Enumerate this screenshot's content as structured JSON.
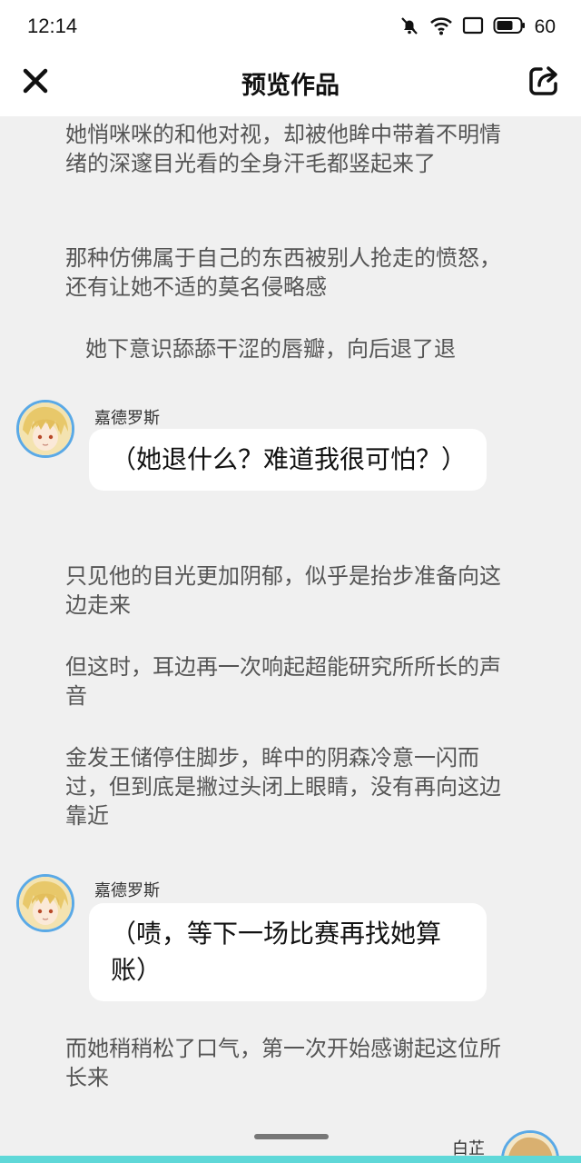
{
  "status_bar": {
    "time": "12:14",
    "battery": "60",
    "icons": [
      "mute-bell-icon",
      "wifi-icon",
      "screen-icon",
      "battery-icon"
    ]
  },
  "header": {
    "title": "预览作品",
    "close_icon": "close-icon",
    "share_icon": "share-icon"
  },
  "story": {
    "narration_1": "她悄咪咪的和他对视，却被他眸中带着不明情绪的深邃目光看的全身汗毛都竖起来了",
    "narration_2": "那种仿佛属于自己的东西被别人抢走的愤怒，还有让她不适的莫名侵略感",
    "narration_3": "她下意识舔舔干涩的唇瓣，向后退了退",
    "dialogue_1": {
      "speaker": "嘉德罗斯",
      "text": "（她退什么？难道我很可怕？）"
    },
    "narration_4": "只见他的目光更加阴郁，似乎是抬步准备向这边走来",
    "narration_5": "但这时，耳边再一次响起超能研究所所长的声音",
    "narration_6": "金发王储停住脚步，眸中的阴森冷意一闪而过，但到底是撇过头闭上眼睛，没有再向这边靠近",
    "dialogue_2": {
      "speaker": "嘉德罗斯",
      "text": "（啧，等下一场比赛再找她算账）"
    },
    "narration_7": "而她稍稍松了口气，第一次开始感谢起这位所长来",
    "dialogue_3": {
      "speaker": "白芷"
    }
  },
  "colors": {
    "background": "#f0f0f0",
    "avatar_border": "#5aa9e6",
    "bottom_strip": "#5fd8d8"
  }
}
